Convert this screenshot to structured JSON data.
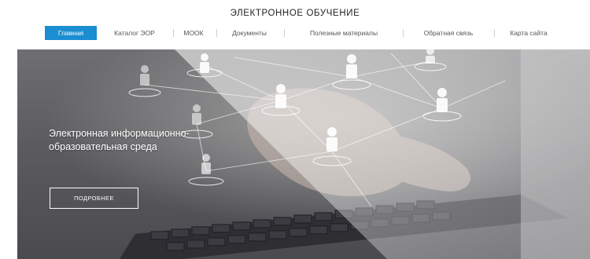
{
  "header": {
    "site_title": "ЭЛЕКТРОННОЕ ОБУЧЕНИЕ"
  },
  "nav": {
    "items": [
      {
        "label": "Главная",
        "active": true
      },
      {
        "label": "Каталог ЭОР",
        "active": false
      },
      {
        "label": "МООК",
        "active": false
      },
      {
        "label": "Документы",
        "active": false
      },
      {
        "label": "Полезные материалы",
        "active": false
      },
      {
        "label": "Обратная связь",
        "active": false
      },
      {
        "label": "Карта сайта",
        "active": false
      }
    ]
  },
  "hero": {
    "text": "Электронная информационно-образовательная среда",
    "button_label": "ПОДРОБНЕЕ"
  },
  "colors": {
    "accent": "#1a8ed1",
    "hero_overlay": "#ffffff"
  },
  "icons": [
    "person-network-icon"
  ]
}
